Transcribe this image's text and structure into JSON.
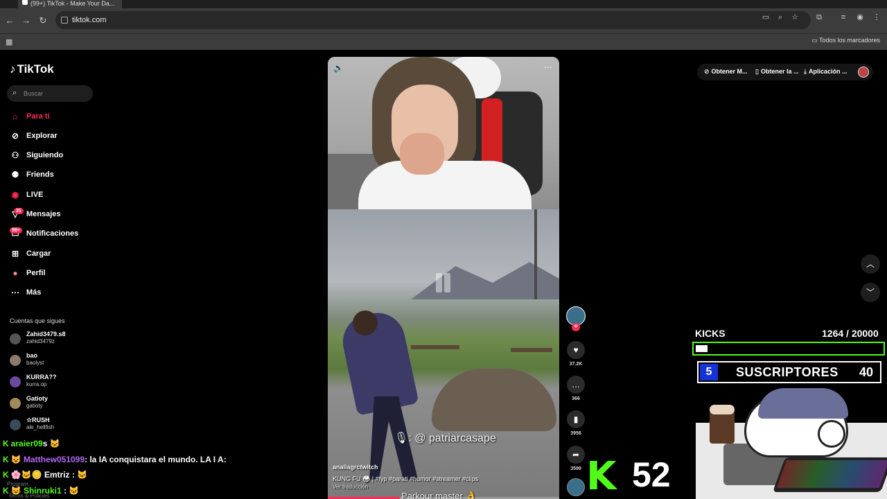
{
  "browser": {
    "tab_title": "(99+) TikTok - Make Your Da...",
    "url": "tiktok.com",
    "bookmarks_label": "Todos los marcadores"
  },
  "sidebar": {
    "logo": "TikTok",
    "search_placeholder": "Buscar",
    "nav": [
      {
        "label": "Para ti",
        "icon": "home-icon",
        "active": true
      },
      {
        "label": "Explorar",
        "icon": "compass-icon"
      },
      {
        "label": "Siguiendo",
        "icon": "following-icon"
      },
      {
        "label": "Friends",
        "icon": "friends-icon"
      },
      {
        "label": "LIVE",
        "icon": "live-icon"
      },
      {
        "label": "Mensajes",
        "icon": "message-icon",
        "badge": "31"
      },
      {
        "label": "Notificaciones",
        "icon": "bell-icon",
        "badge": "99+"
      },
      {
        "label": "Cargar",
        "icon": "upload-icon"
      },
      {
        "label": "Perfil",
        "icon": "profile-icon"
      },
      {
        "label": "Más",
        "icon": "more-icon"
      }
    ],
    "following_title": "Cuentas que sigues",
    "accounts": [
      {
        "name": "Zahid3479.s8",
        "handle": "zahid3479z"
      },
      {
        "name": "bao",
        "handle": "baolyst"
      },
      {
        "name": "KURRA??",
        "handle": "kurra.op"
      },
      {
        "name": "Gatioty",
        "handle": "gatioty"
      },
      {
        "name": "☆RUSH",
        "handle": "ale_hellfish"
      }
    ],
    "footer_1": "Program",
    "footer_2": "Terms & Policies"
  },
  "chat": [
    {
      "user": "araier09",
      "message": "s",
      "color": "#53fc18"
    },
    {
      "user": "Matthew051099",
      "message": ": la IA conquistara el mundo. LA I A:",
      "color": "#b667f5"
    },
    {
      "user": "Emtriz",
      "message": ":",
      "color": "#ffffff"
    },
    {
      "user": "Shinruki1",
      "message": ":",
      "color": "#53fc18"
    }
  ],
  "video": {
    "overlay_tag": ": @ patriarcasape",
    "author": "analiagrctwitch",
    "caption": "KUNG FU 🥋 | #fyp #parati #humor #streamer #clips",
    "translate_link": "Ver traducción",
    "bottom_text": "Parkour master 👌",
    "progress": 0.31
  },
  "actions": {
    "likes": "37.2K",
    "comments": "366",
    "saves": "3956",
    "shares": "3599"
  },
  "top_right": {
    "pill_1": "Obtener M...",
    "pill_2": "Obtener la ...",
    "pill_3": "Aplicación ..."
  },
  "overlay": {
    "kicks_label": "KICKS",
    "kicks_count": "1264  / 20000",
    "kicks_current": 1264,
    "kicks_goal": 20000,
    "subs_num": "5",
    "subs_label": "SUSCRIPTORES",
    "subs_goal": "40",
    "kick_logo": "K",
    "viewers": "52"
  },
  "colors": {
    "accent": "#fe2c55",
    "kick_green": "#53fc18",
    "subs_blue": "#1433d6"
  }
}
